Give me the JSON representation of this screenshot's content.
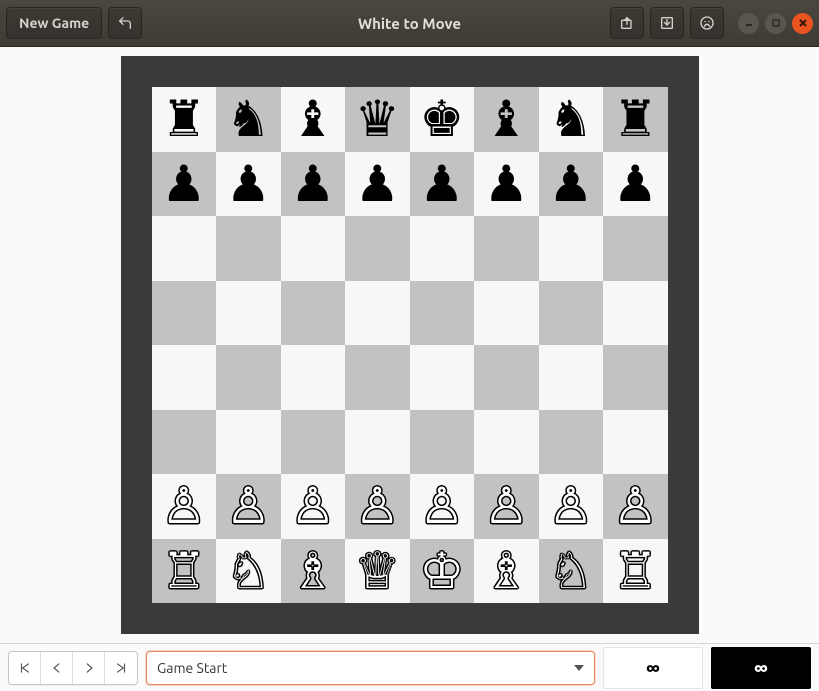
{
  "header": {
    "new_game_label": "New Game",
    "title": "White to Move"
  },
  "toolbar": {
    "history_selected": "Game Start"
  },
  "clocks": {
    "white": "∞",
    "black": "∞"
  },
  "board": {
    "orientation": "white_bottom",
    "squares": [
      [
        "br",
        "bn",
        "bb",
        "bq",
        "bk",
        "bb",
        "bn",
        "br"
      ],
      [
        "bp",
        "bp",
        "bp",
        "bp",
        "bp",
        "bp",
        "bp",
        "bp"
      ],
      [
        "",
        "",
        "",
        "",
        "",
        "",
        "",
        ""
      ],
      [
        "",
        "",
        "",
        "",
        "",
        "",
        "",
        ""
      ],
      [
        "",
        "",
        "",
        "",
        "",
        "",
        "",
        ""
      ],
      [
        "",
        "",
        "",
        "",
        "",
        "",
        "",
        ""
      ],
      [
        "wp",
        "wp",
        "wp",
        "wp",
        "wp",
        "wp",
        "wp",
        "wp"
      ],
      [
        "wr",
        "wn",
        "wb",
        "wq",
        "wk",
        "wb",
        "wn",
        "wr"
      ]
    ]
  },
  "piece_glyphs": {
    "wk": "♔",
    "wq": "♕",
    "wr": "♖",
    "wb": "♗",
    "wn": "♘",
    "wp": "♙",
    "bk": "♚",
    "bq": "♛",
    "br": "♜",
    "bb": "♝",
    "bn": "♞",
    "bp": "♟"
  }
}
